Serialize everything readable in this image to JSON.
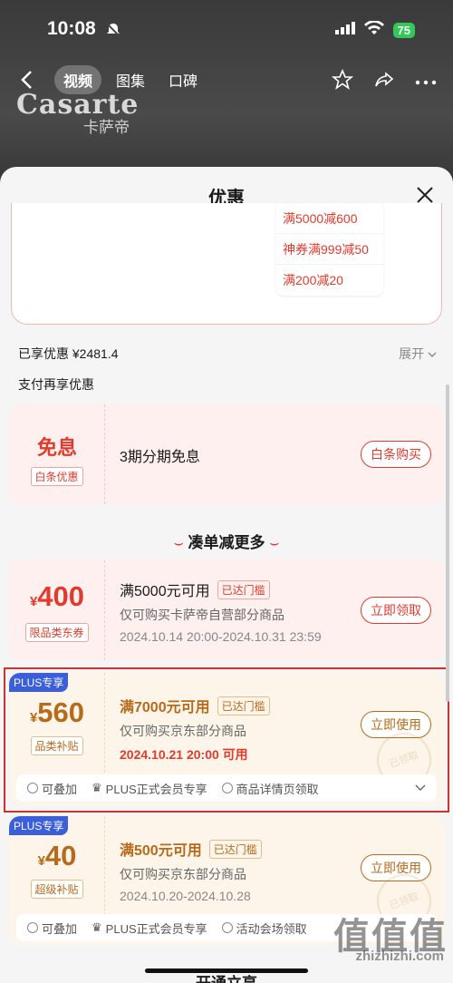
{
  "status_bar": {
    "time": "10:08",
    "battery": "75"
  },
  "top_nav": {
    "tabs": [
      "视频",
      "图集",
      "口碑"
    ]
  },
  "brand": {
    "name": "Casarte",
    "cn": "卡萨帝"
  },
  "sheet": {
    "title": "优惠",
    "mini_discounts": [
      "满5000减600",
      "神券满999减50",
      "满200减20"
    ],
    "enjoyed": "已享优惠 ¥2481.4",
    "expand": "展开",
    "pay_title": "支付再享优惠"
  },
  "baitiao": {
    "title": "免息",
    "tag": "白条优惠",
    "desc": "3期分期免息",
    "button": "白条购买"
  },
  "section_more": {
    "title": "凑单减更多",
    "deco": "⌣"
  },
  "coupons": [
    {
      "symbol": "¥",
      "amount": "400",
      "tag": "限品类东券",
      "condition": "满5000元可用",
      "reach": "已达门槛",
      "scope": "仅可购买卡萨帝自营部分商品",
      "time": "2024.10.14 20:00-2024.10.31 23:59",
      "button": "立即领取"
    },
    {
      "badge": "PLUS专享",
      "symbol": "¥",
      "amount": "560",
      "tag": "品类补贴",
      "condition": "满7000元可用",
      "reach": "已达门槛",
      "scope": "仅可购买京东部分商品",
      "time": "2024.10.21 20:00 可用",
      "button": "立即使用",
      "stamp": "已领取",
      "footer": [
        "可叠加",
        "PLUS正式会员专享",
        "商品详情页领取"
      ]
    },
    {
      "badge": "PLUS专享",
      "symbol": "¥",
      "amount": "40",
      "tag": "超级补贴",
      "condition": "满500元可用",
      "reach": "已达门槛",
      "scope": "仅可购买京东部分商品",
      "time": "2024.10.20-2024.10.28",
      "button": "立即使用",
      "stamp": "已领取",
      "footer": [
        "可叠加",
        "PLUS正式会员专享",
        "活动会场领取"
      ]
    }
  ],
  "bottom_section": "开通立享",
  "watermark": {
    "logo": "值值值",
    "site": "zhizhizhi.com"
  }
}
